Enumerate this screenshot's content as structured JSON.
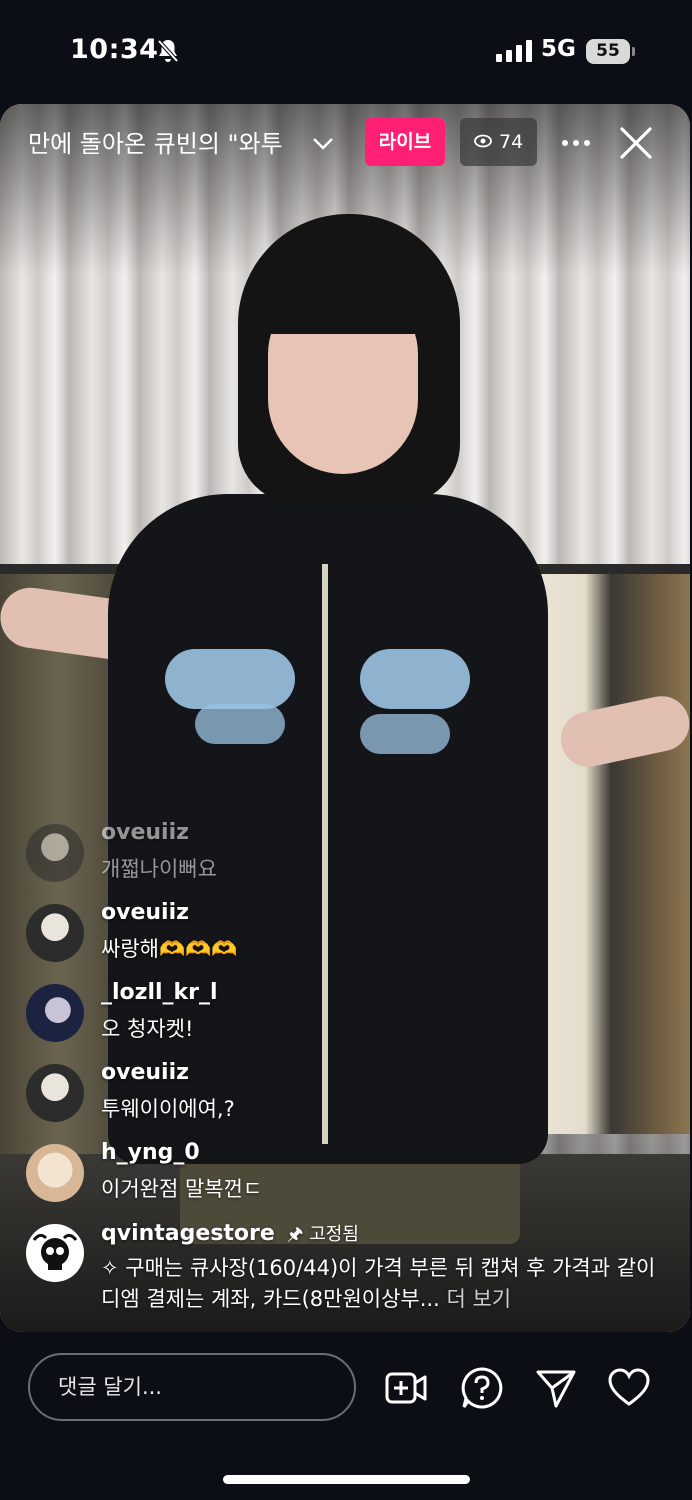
{
  "status_bar": {
    "time": "10:34",
    "network": "5G",
    "battery": "55"
  },
  "header": {
    "title": "만에 돌아온 큐빈의 \"와투",
    "live_label": "라이브",
    "viewer_count": "74"
  },
  "comments": [
    {
      "username": "oveuiiz",
      "text": "개쩗나이뻐요",
      "faded": true
    },
    {
      "username": "oveuiiz",
      "text": "싸랑해🫶🫶🫶"
    },
    {
      "username": "_lozll_kr_l",
      "text": "오 청자켓!"
    },
    {
      "username": "oveuiiz",
      "text": "투웨이이에여,?"
    },
    {
      "username": "h_yng_0",
      "text": "이거완점 말복껀ㄷ"
    }
  ],
  "pinned_comment": {
    "username": "qvintagestore",
    "pin_label": "고정됨",
    "text": "구매는 큐사장(160/44)이 가격 부른 뒤 캡쳐 후 가격과 같이 디엠 결제는 계좌, 카드(8만원이상부...",
    "see_more": "더 보기"
  },
  "bottom_bar": {
    "comment_placeholder": "댓글 달기...",
    "icons": [
      "add-video-icon",
      "question-icon",
      "send-icon",
      "heart-icon"
    ]
  },
  "colors": {
    "live_badge": "#ff1f74",
    "background": "#0b0e14"
  }
}
